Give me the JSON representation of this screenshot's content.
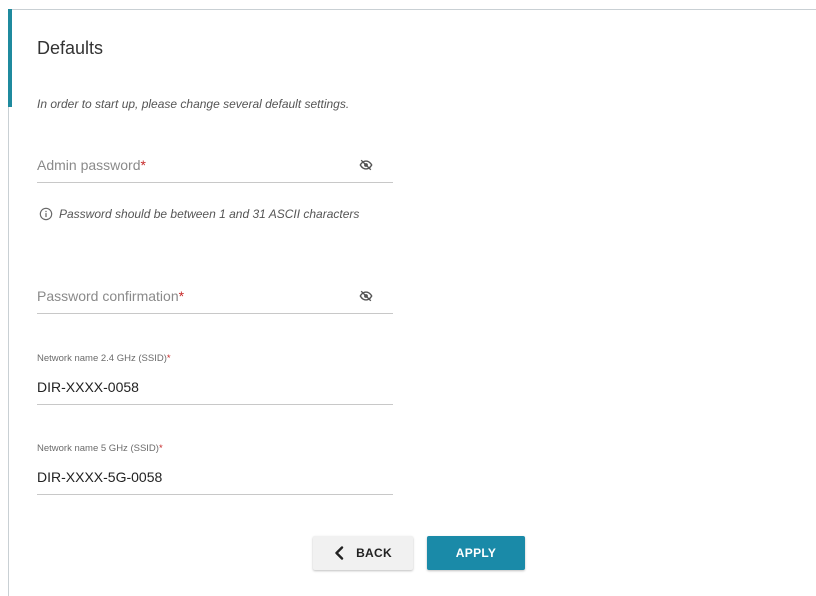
{
  "page": {
    "title": "Defaults",
    "intro": "In order to start up, please change several default settings."
  },
  "admin_password": {
    "label": "Admin password",
    "required_mark": "*",
    "toggle_icon": "eye-off-icon"
  },
  "password_hint": {
    "icon": "info-icon",
    "text": "Password should be between 1 and 31 ASCII characters"
  },
  "password_confirmation": {
    "label": "Password confirmation",
    "required_mark": "*",
    "toggle_icon": "eye-off-icon"
  },
  "ssid_24": {
    "label": "Network name 2.4 GHz (SSID)",
    "required_mark": "*",
    "value": "DIR-XXXX-0058"
  },
  "ssid_5": {
    "label": "Network name 5 GHz (SSID)",
    "required_mark": "*",
    "value": "DIR-XXXX-5G-0058"
  },
  "buttons": {
    "back_label": "BACK",
    "apply_label": "APPLY"
  },
  "colors": {
    "accent": "#1f8a9e",
    "apply_button": "#1a8aa8",
    "required": "#c62828"
  }
}
